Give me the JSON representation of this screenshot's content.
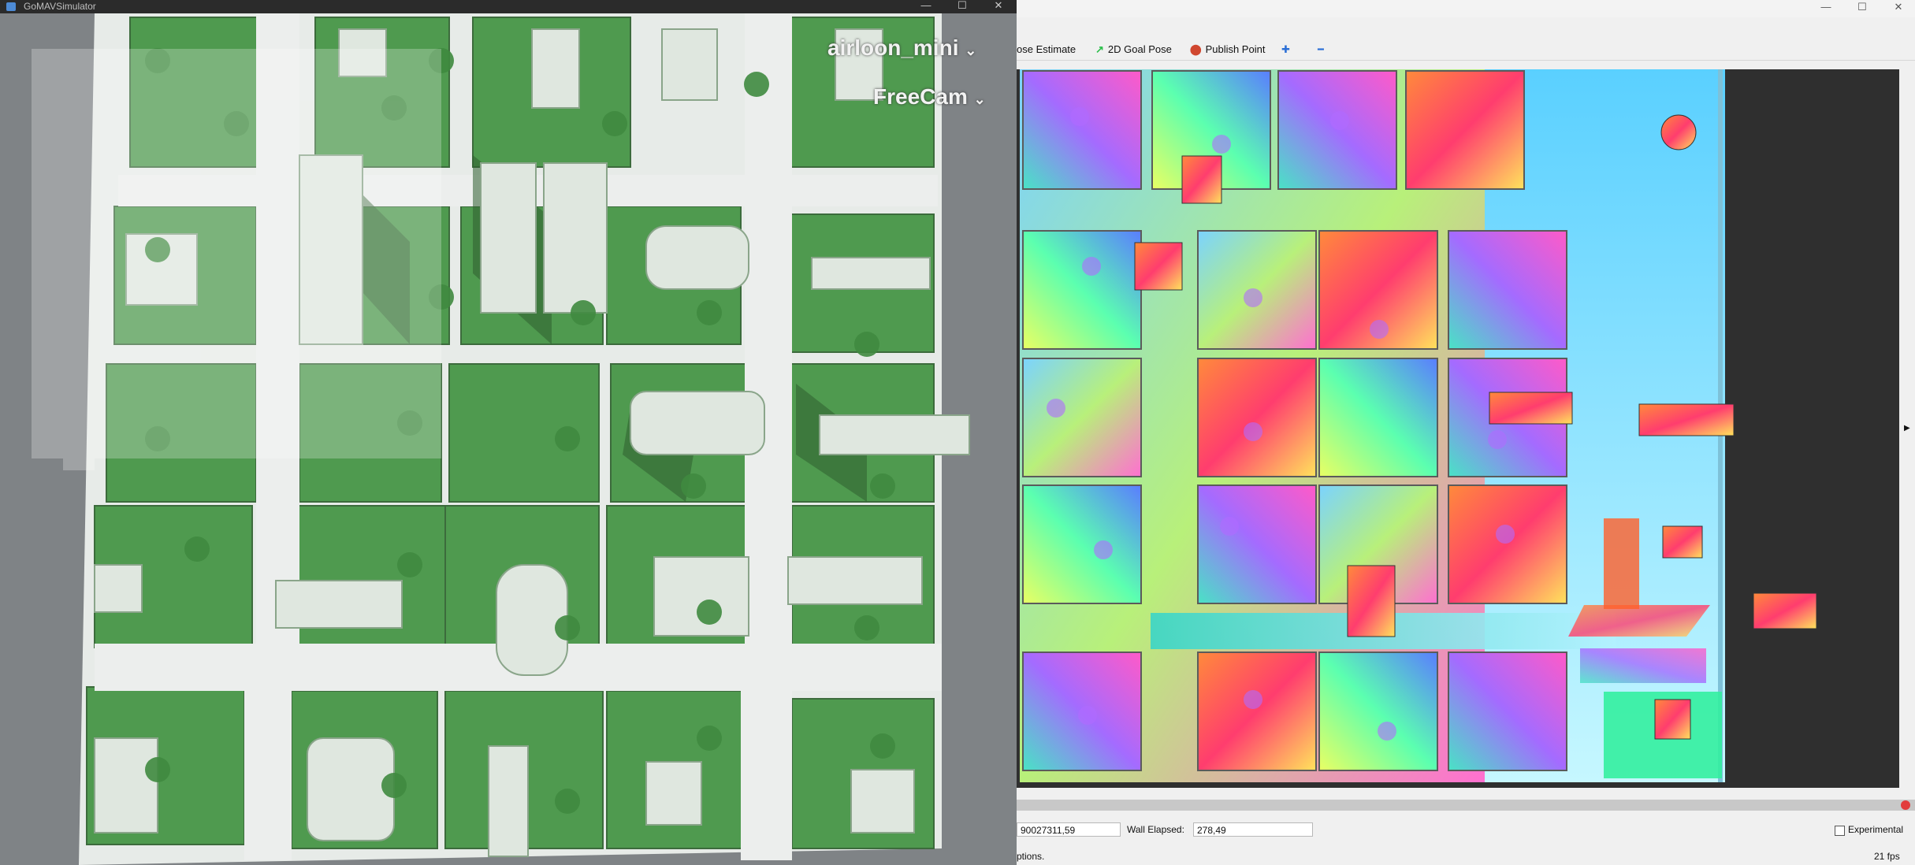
{
  "sim": {
    "title": "GoMAVSimulator",
    "vehicle_select": "airloon_mini",
    "camera_select": "FreeCam",
    "chevron": "⌄"
  },
  "rviz": {
    "window_controls": [
      "—",
      "☐",
      "✕"
    ],
    "toolbar": {
      "pose_estimate": "ose Estimate",
      "goal_pose": "2D Goal Pose",
      "publish_point": "Publish Point",
      "zoom_in": "✚",
      "zoom_out": "━"
    },
    "status": {
      "ros_time_value": "90027311,59",
      "wall_elapsed_label": "Wall Elapsed:",
      "wall_elapsed_value": "278,49",
      "options_text": "ptions.",
      "experimental_label": "Experimental",
      "fps": "21 fps"
    }
  },
  "colors": {
    "grass": "#4f9a4f",
    "road": "#e9ecea",
    "building": "#dfe7df",
    "rviz_bg": "#2f2f2f"
  }
}
